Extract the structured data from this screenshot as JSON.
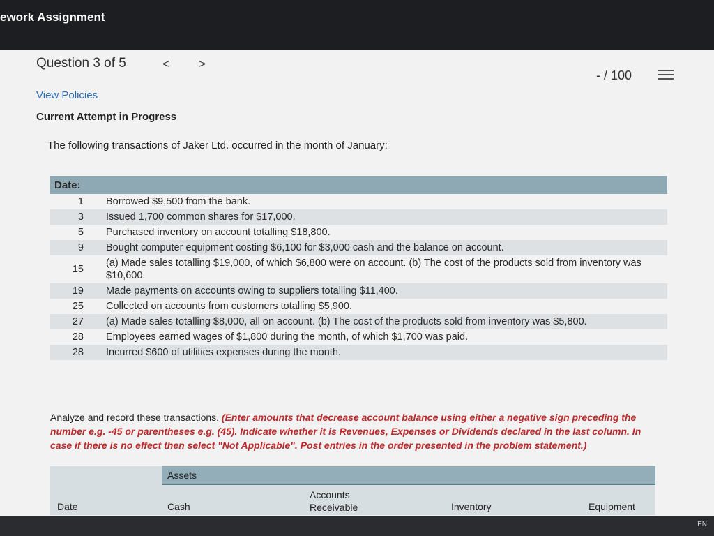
{
  "app": {
    "title": "ework Assignment"
  },
  "question": {
    "label": "Question 3 of 5",
    "prev": "<",
    "next": ">",
    "score": "- / 100"
  },
  "links": {
    "view_policies": "View Policies"
  },
  "status": {
    "attempt": "Current Attempt in Progress"
  },
  "problem": {
    "intro": "The following transactions of Jaker Ltd. occurred in the month of January:",
    "table_header": "Date:",
    "transactions": [
      {
        "day": "1",
        "text": "Borrowed $9,500 from the bank."
      },
      {
        "day": "3",
        "text": "Issued 1,700 common shares for $17,000."
      },
      {
        "day": "5",
        "text": "Purchased inventory on account totalling $18,800."
      },
      {
        "day": "9",
        "text": "Bought computer equipment costing $6,100 for $3,000 cash and the balance on account."
      },
      {
        "day": "15",
        "text": "(a) Made sales totalling $19,000, of which $6,800 were on account. (b) The cost of the products sold from inventory was $10,600."
      },
      {
        "day": "19",
        "text": "Made payments on accounts owing to suppliers totalling $11,400."
      },
      {
        "day": "25",
        "text": "Collected on accounts from customers totalling $5,900."
      },
      {
        "day": "27",
        "text": "(a) Made sales totalling $8,000, all on account. (b) The cost of the products sold from inventory was $5,800."
      },
      {
        "day": "28",
        "text": "Employees earned wages of $1,800 during the month, of which $1,700 was paid."
      },
      {
        "day": "28",
        "text": "Incurred $600 of utilities expenses during the month."
      }
    ],
    "instruction_plain": "Analyze and record these transactions. ",
    "instruction_red": "(Enter amounts that decrease account balance using either a negative sign preceding the number e.g. -45 or parentheses e.g. (45). Indicate whether it is Revenues, Expenses or Dividends declared in the last column. In case if there is no effect then select \"Not Applicable\". Post entries in the order presented in the problem statement.)"
  },
  "grid": {
    "group_header": "Assets",
    "columns": [
      "Date",
      "Cash",
      "Accounts Receivable",
      "Inventory",
      "Equipment"
    ]
  },
  "taskbar": {
    "lang": "EN"
  }
}
